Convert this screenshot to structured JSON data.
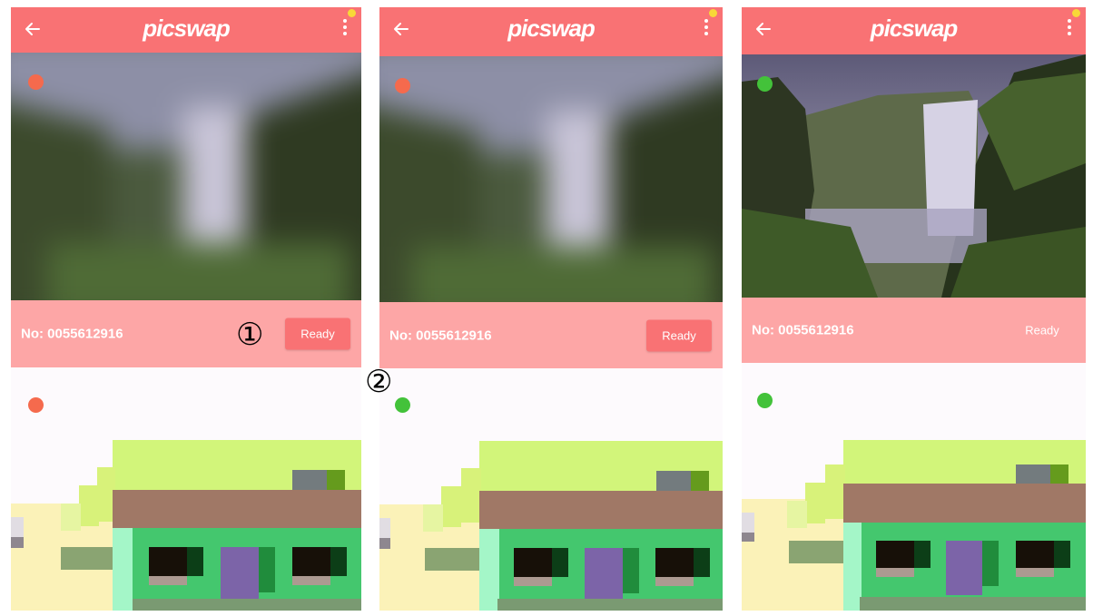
{
  "app": {
    "logo_text": "picswap",
    "brand_color": "#f97274",
    "infobar_color": "#fda6a6",
    "notification_color": "#f8d838"
  },
  "panels": [
    {
      "serial": "No: 0055612916",
      "ready_label": "Ready",
      "photo_state": "blurred",
      "photo_status": "red",
      "art_status": "red"
    },
    {
      "serial": "No: 0055612916",
      "ready_label": "Ready",
      "photo_state": "blurred",
      "photo_status": "red",
      "art_status": "green"
    },
    {
      "serial": "No: 0055612916",
      "ready_label": "Ready",
      "photo_state": "sharp",
      "photo_status": "green",
      "art_status": "green"
    }
  ],
  "icons": {
    "back": "arrow-left-icon",
    "menu": "more-vertical-icon"
  },
  "status_colors": {
    "red": "#f56a4d",
    "green": "#43c23a"
  },
  "annotations": {
    "marker_1": "①",
    "marker_2": "②"
  }
}
